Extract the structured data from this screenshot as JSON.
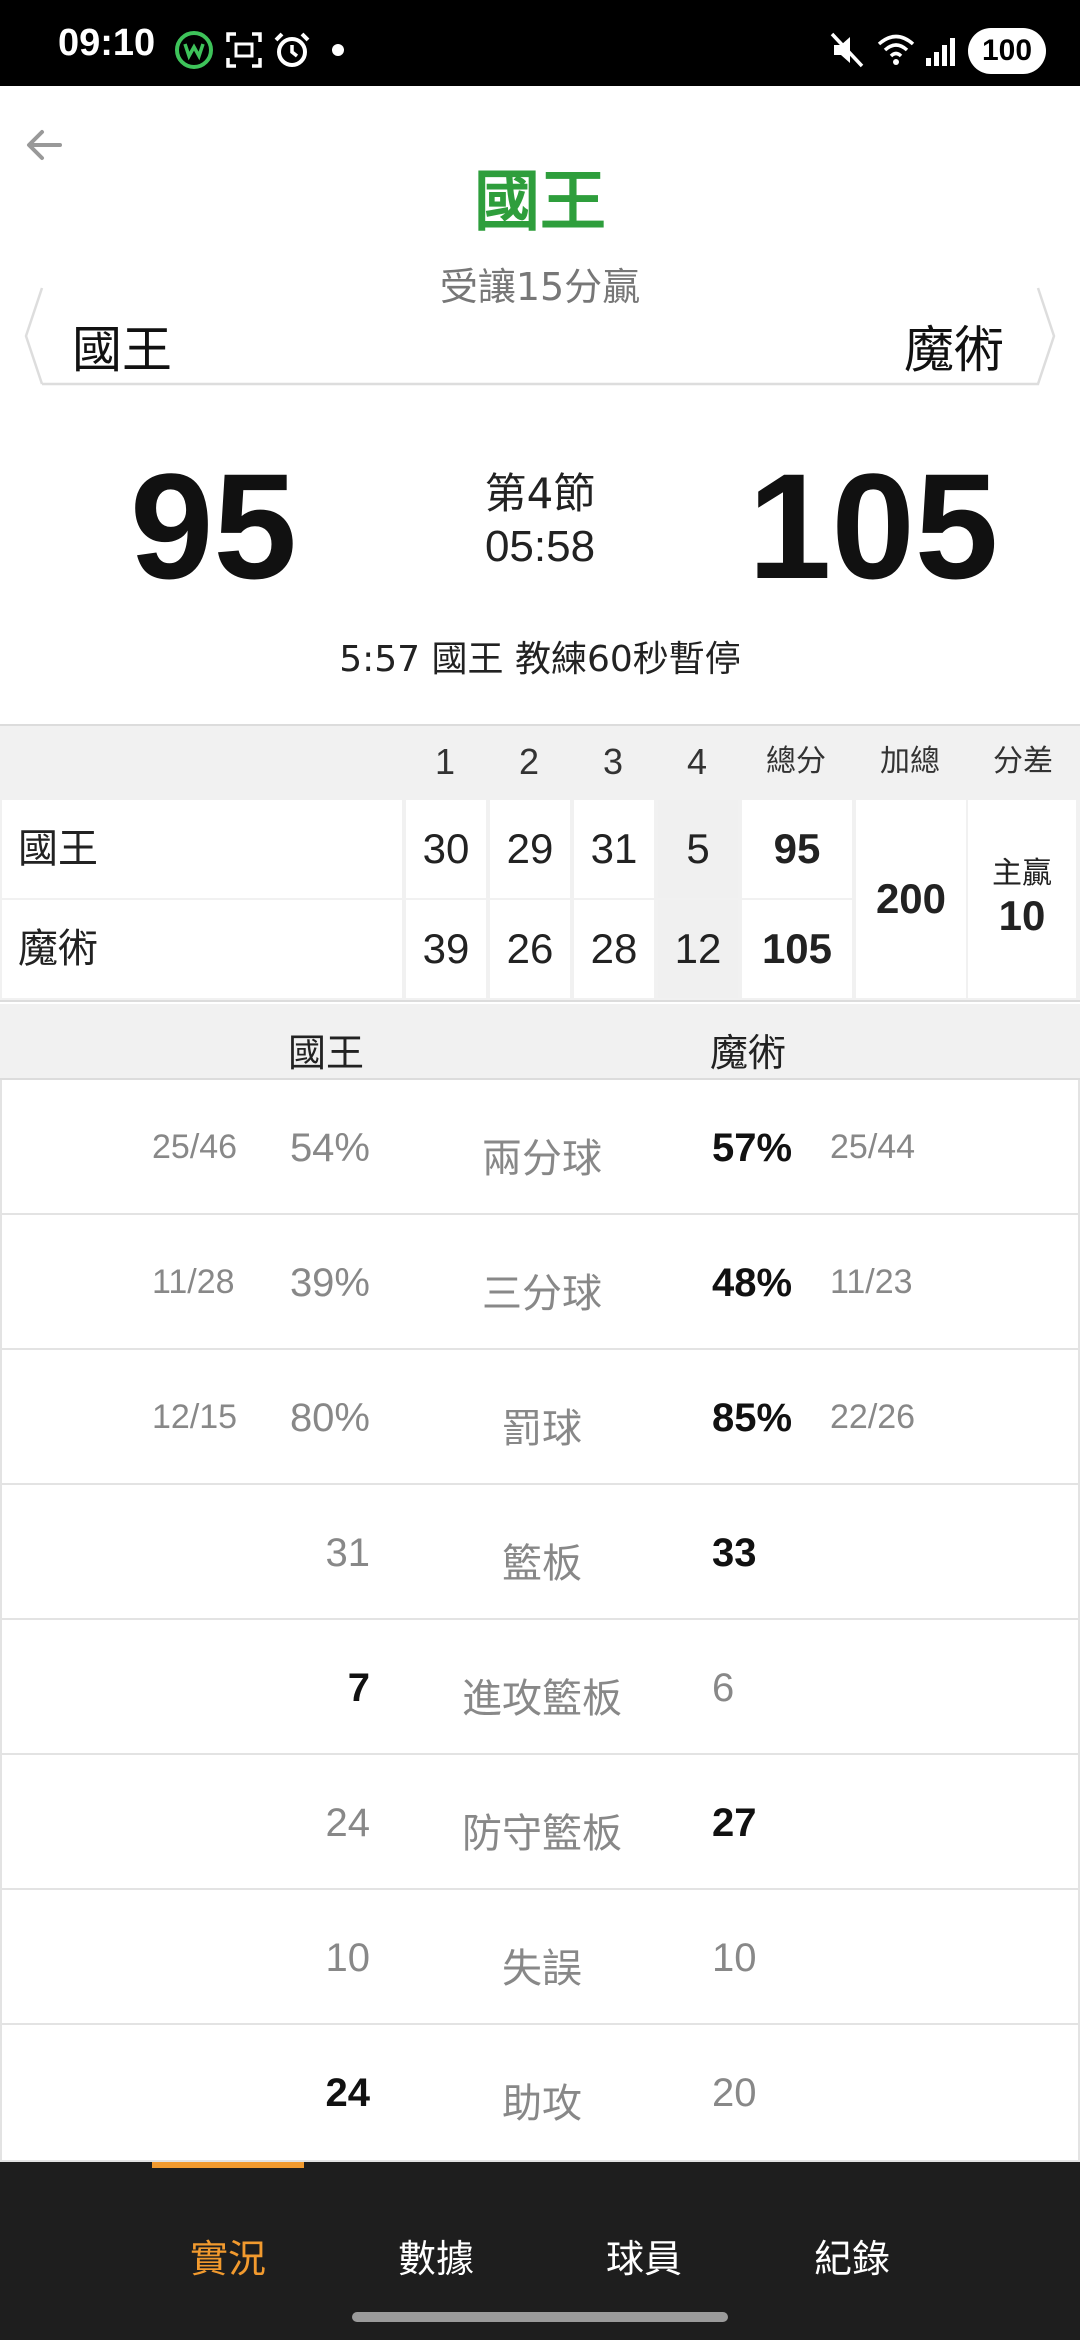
{
  "status": {
    "time": "09:10",
    "battery": "100"
  },
  "header": {
    "winner": "國王",
    "handicap": "受讓15分贏",
    "home_team": "國王",
    "away_team": "魔術"
  },
  "score": {
    "home": "95",
    "away": "105",
    "period": "第4節",
    "clock": "05:58",
    "event": "5:57 國王  教練60秒暫停"
  },
  "box": {
    "headers": [
      "1",
      "2",
      "3",
      "4",
      "總分",
      "加總",
      "分差"
    ],
    "rows": [
      {
        "team": "國王",
        "q": [
          "30",
          "29",
          "31",
          "5"
        ],
        "total": "95"
      },
      {
        "team": "魔術",
        "q": [
          "39",
          "26",
          "28",
          "12"
        ],
        "total": "105"
      }
    ],
    "sum": "200",
    "diff_label": "主贏",
    "diff_value": "10"
  },
  "stats": {
    "home_name": "國王",
    "away_name": "魔術",
    "rows": [
      {
        "label": "兩分球",
        "home_frac": "25/46",
        "home": "54%",
        "away": "57%",
        "away_frac": "25/44"
      },
      {
        "label": "三分球",
        "home_frac": "11/28",
        "home": "39%",
        "away": "48%",
        "away_frac": "11/23"
      },
      {
        "label": "罰球",
        "home_frac": "12/15",
        "home": "80%",
        "away": "85%",
        "away_frac": "22/26"
      },
      {
        "label": "籃板",
        "home_frac": "",
        "home": "31",
        "away": "33",
        "away_frac": ""
      },
      {
        "label": "進攻籃板",
        "home_frac": "",
        "home": "7",
        "away": "6",
        "away_frac": ""
      },
      {
        "label": "防守籃板",
        "home_frac": "",
        "home": "24",
        "away": "27",
        "away_frac": ""
      },
      {
        "label": "失誤",
        "home_frac": "",
        "home": "10",
        "away": "10",
        "away_frac": ""
      },
      {
        "label": "助攻",
        "home_frac": "",
        "home": "24",
        "away": "20",
        "away_frac": ""
      }
    ]
  },
  "nav": {
    "tabs": [
      "實況",
      "數據",
      "球員",
      "紀錄"
    ],
    "active": 0
  },
  "colors": {
    "winner": "#2e9e3c",
    "accent": "#f29a2e"
  }
}
